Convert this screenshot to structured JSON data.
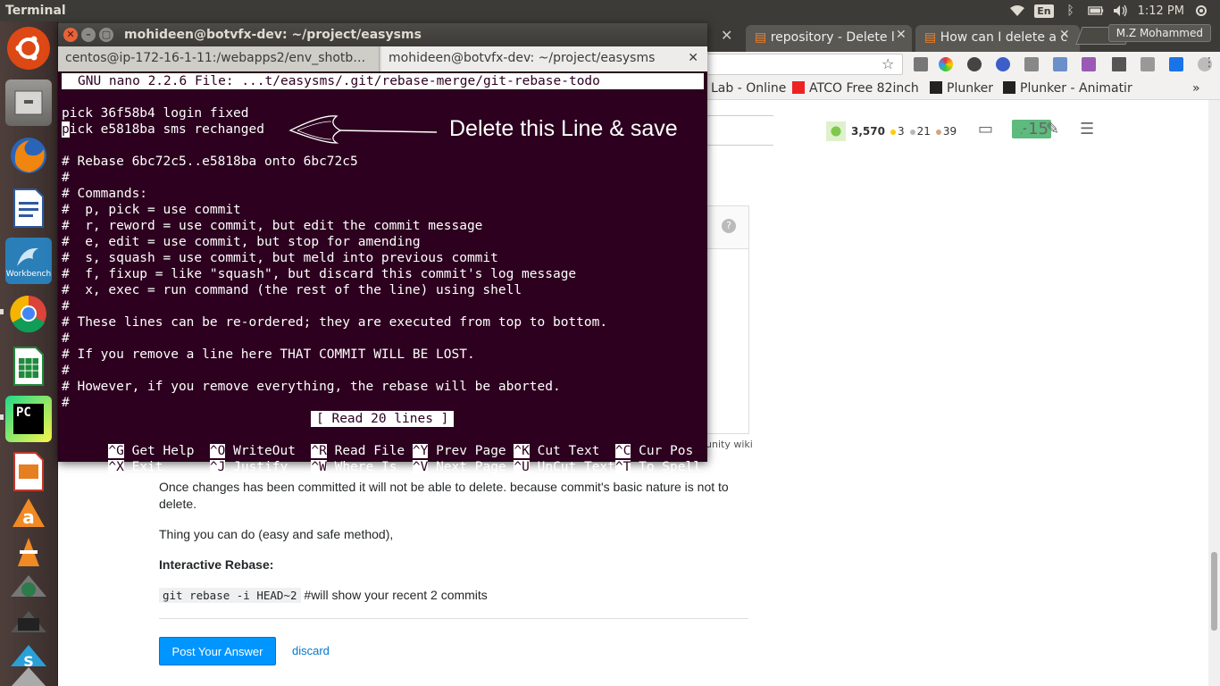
{
  "top_panel": {
    "app_name": "Terminal",
    "keyboard": "En",
    "clock": "1:12 PM"
  },
  "launcher": {
    "items": [
      "ubuntu-dash",
      "files",
      "firefox",
      "libreoffice-writer",
      "mysql-workbench",
      "chrome",
      "libreoffice-calc",
      "pycharm",
      "libreoffice-impress",
      "amazon",
      "vlc",
      "screenshot",
      "system-settings",
      "terminal",
      "stacked-app",
      "trash"
    ],
    "workbench_label": "Workbench"
  },
  "browser": {
    "tabs": [
      {
        "label": "repository - Delete l",
        "active": false
      },
      {
        "label": "How can I delete a c",
        "active": true
      }
    ],
    "profile": "M.Z Mohammed",
    "bookmarks": [
      {
        "label": "Lab - Online"
      },
      {
        "label": "ATCO Free 82inch"
      },
      {
        "label": "Plunker"
      },
      {
        "label": "Plunker - Animatir"
      }
    ],
    "bookmarks_more": "»",
    "stats": {
      "reputation": "3,570",
      "gold": "3",
      "silver": "21",
      "bronze": "39",
      "plus": "+15"
    },
    "community_wiki": "unity wiki",
    "answer": {
      "p1": "Once changes has been committed it will not be able to delete. because commit's basic nature is not to delete.",
      "p2": "Thing you can do (easy and safe method),",
      "p3": "Interactive Rebase:",
      "code": "git rebase -i HEAD~2",
      "p4_suffix": " #will show your recent 2 commits"
    },
    "post_button": "Post Your Answer",
    "discard": "discard"
  },
  "terminal": {
    "title": "mohideen@botvfx-dev: ~/project/easysms",
    "tabs": [
      {
        "label": "centos@ip-172-16-1-11:/webapps2/env_shotb…",
        "active": false
      },
      {
        "label": "mohideen@botvfx-dev: ~/project/easysms",
        "active": true
      }
    ],
    "nano_header": "GNU nano 2.2.6 File: ...t/easysms/.git/rebase-merge/git-rebase-todo",
    "lines": [
      "pick 36f58b4 login fixed",
      "pick e5818ba sms rechanged",
      "",
      "# Rebase 6bc72c5..e5818ba onto 6bc72c5",
      "#",
      "# Commands:",
      "#  p, pick = use commit",
      "#  r, reword = use commit, but edit the commit message",
      "#  e, edit = use commit, but stop for amending",
      "#  s, squash = use commit, but meld into previous commit",
      "#  f, fixup = like \"squash\", but discard this commit's log message",
      "#  x, exec = run command (the rest of the line) using shell",
      "#",
      "# These lines can be re-ordered; they are executed from top to bottom.",
      "#",
      "# If you remove a line here THAT COMMIT WILL BE LOST.",
      "#",
      "# However, if you remove everything, the rebase will be aborted.",
      "#"
    ],
    "cursor_char": "p",
    "line2_rest": "ick e5818ba sms rechanged",
    "status": "[ Read 20 lines ]",
    "shortcuts_row1": [
      {
        "key": "^G",
        "label": " Get Help  "
      },
      {
        "key": "^O",
        "label": " WriteOut  "
      },
      {
        "key": "^R",
        "label": " Read File "
      },
      {
        "key": "^Y",
        "label": " Prev Page "
      },
      {
        "key": "^K",
        "label": " Cut Text  "
      },
      {
        "key": "^C",
        "label": " Cur Pos"
      }
    ],
    "shortcuts_row2": [
      {
        "key": "^X",
        "label": " Exit      "
      },
      {
        "key": "^J",
        "label": " Justify   "
      },
      {
        "key": "^W",
        "label": " Where Is  "
      },
      {
        "key": "^V",
        "label": " Next Page "
      },
      {
        "key": "^U",
        "label": " UnCut Text"
      },
      {
        "key": "^T",
        "label": " To Spell"
      }
    ],
    "annotation": "Delete this Line & save"
  },
  "colors": {
    "terminal_bg": "#2c001e",
    "panel_bg": "#3c3b37",
    "so_blue": "#0095ff",
    "link": "#0077cc"
  }
}
